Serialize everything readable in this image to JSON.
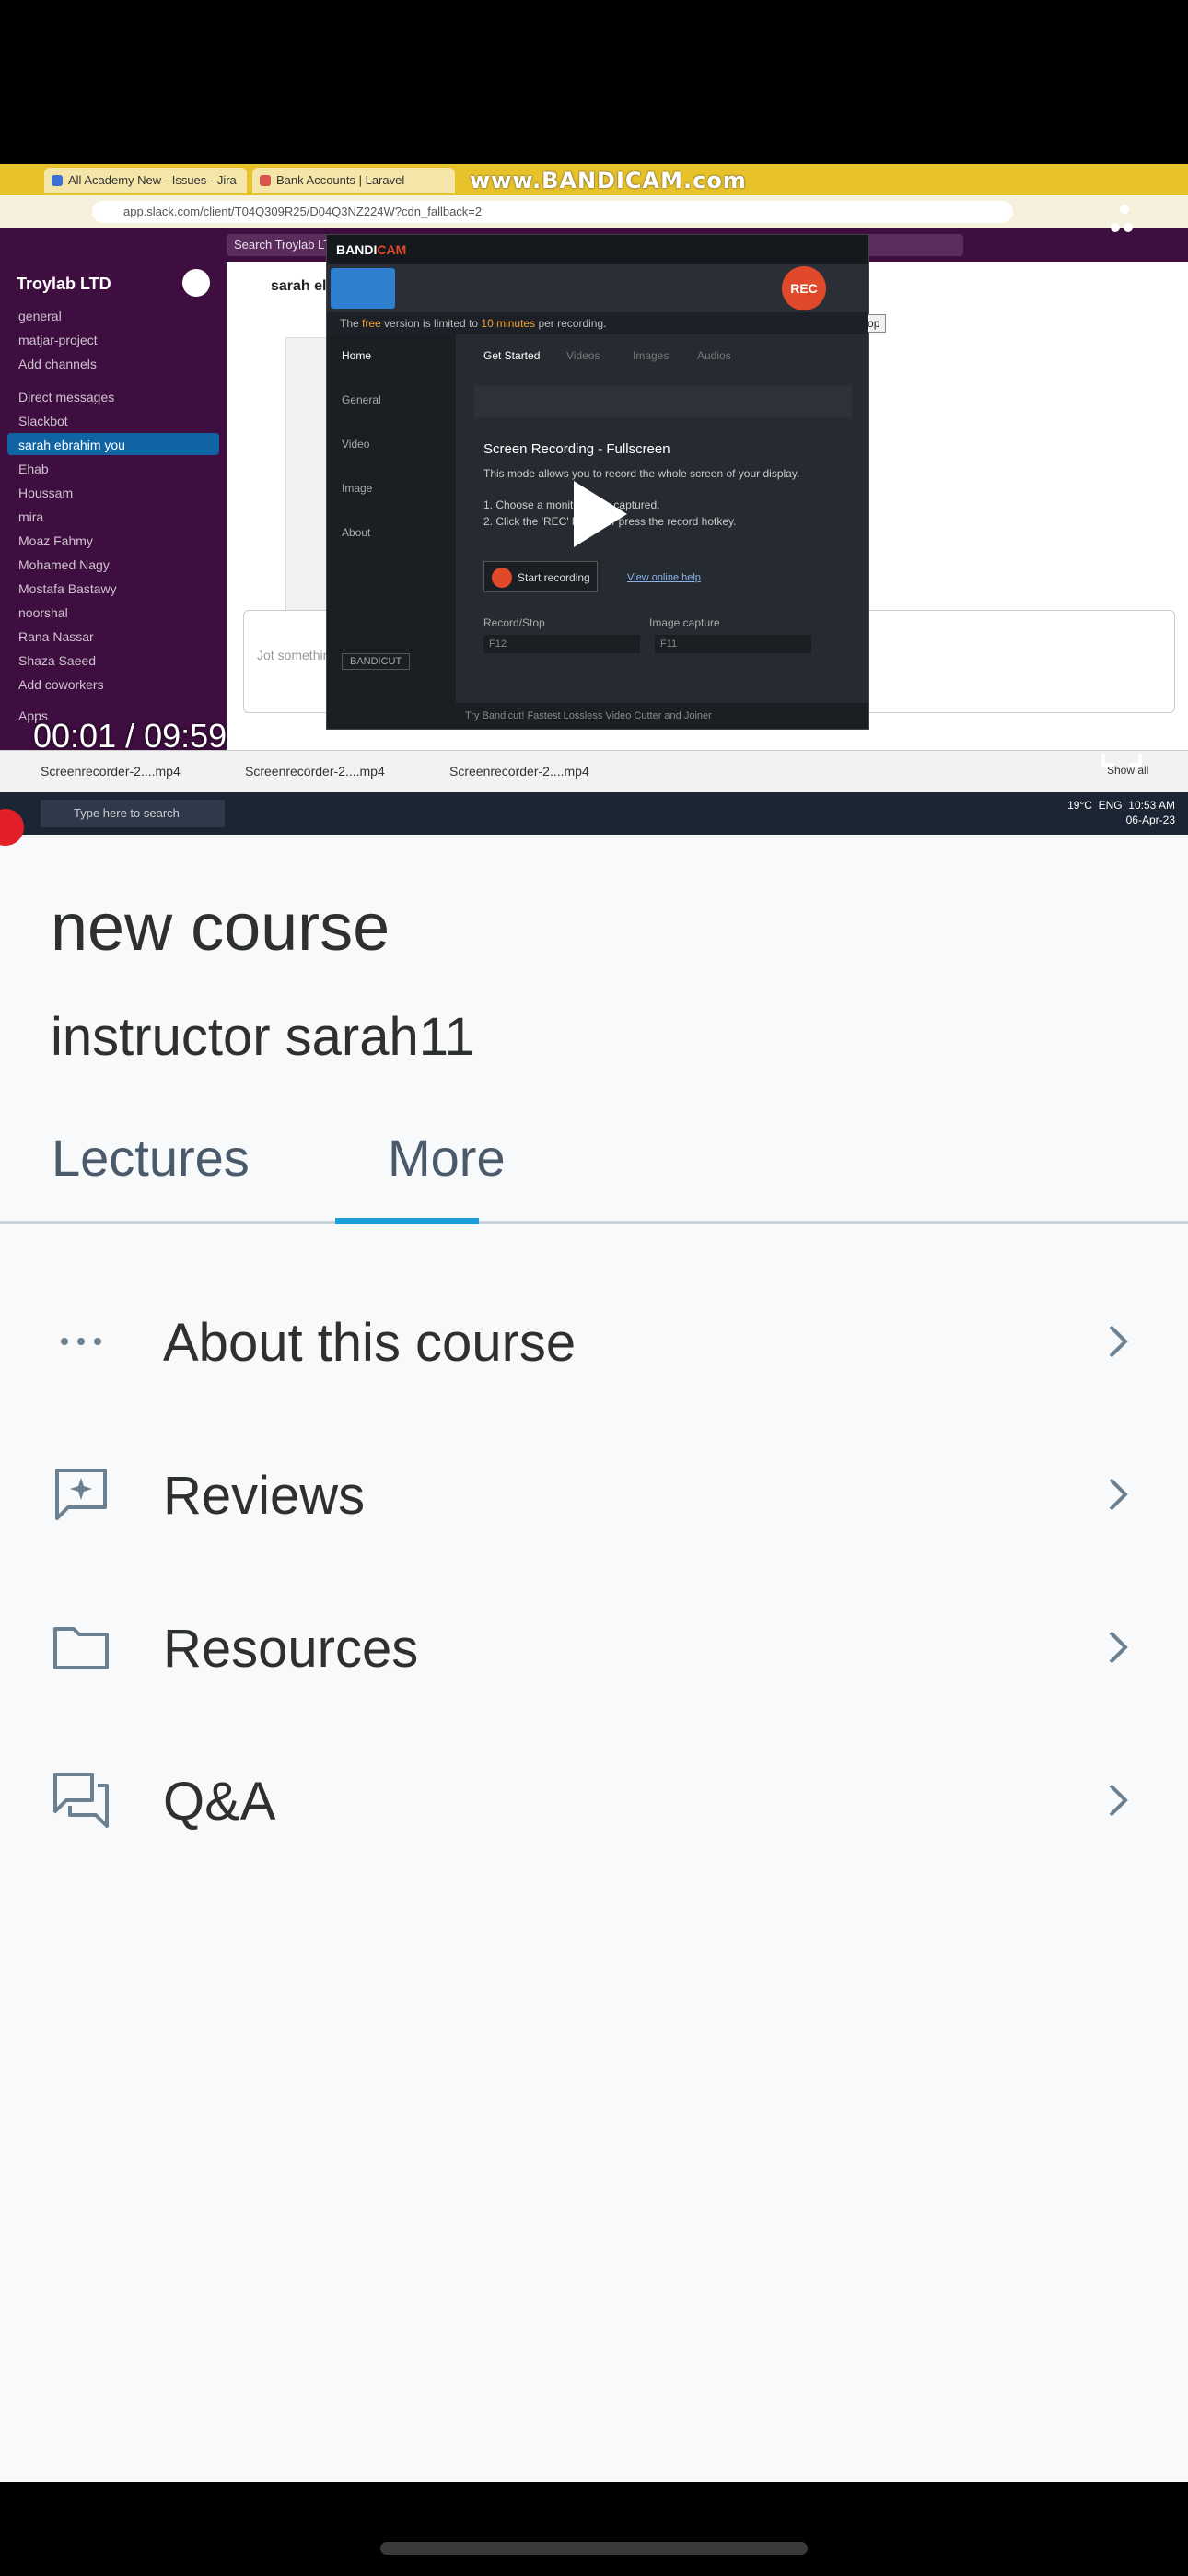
{
  "video": {
    "time_readout": "00:01 / 09:59",
    "recording": {
      "browser_tabs": [
        "All Academy New - Issues - Jira",
        "Bank Accounts | Laravel"
      ],
      "watermark": "www.BANDICAM.com",
      "address": "app.slack.com/client/T04Q309R25/D04Q3NZ224W?cdn_fallback=2",
      "slack_search": "Search Troylab LTD",
      "workspace": "Troylab LTD",
      "sidebar": {
        "channels": [
          "general",
          "matjar-project",
          "Add channels"
        ],
        "dm_header": "Direct messages",
        "dms": [
          "Slackbot",
          "sarah ebrahim  you",
          "Ehab",
          "Houssam",
          "mira",
          "Moaz Fahmy",
          "Mohamed Nagy",
          "Mostafa Bastawy",
          "noorshal",
          "Rana Nassar",
          "Shaza Saeed",
          "Add coworkers"
        ],
        "apps_header": "Apps"
      },
      "chat_header": "sarah el",
      "message_placeholder": "Jot somethin",
      "downloads": [
        "Screenrecorder-2....mp4",
        "Screenrecorder-2....mp4",
        "Screenrecorder-2....mp4"
      ],
      "show_all": "Show all",
      "taskbar_search": "Type here to search",
      "tray": {
        "weather": "19°C",
        "lang": "ENG",
        "time": "10:53 AM",
        "date": "06-Apr-23"
      },
      "bandicam": {
        "logo_a": "BANDI",
        "logo_b": "CAM",
        "rec": "REC",
        "rec_tooltip": "Record / Stop",
        "notice_a": "The ",
        "notice_free": "free",
        "notice_b": " version is limited to ",
        "notice_limit": "10 minutes",
        "notice_c": " per recording.",
        "nav": [
          "Home",
          "General",
          "Video",
          "Image",
          "About"
        ],
        "tabs": [
          "Get Started",
          "Videos",
          "Images",
          "Audios"
        ],
        "heading": "Screen Recording - Fullscreen",
        "desc": "This mode allows you to record the whole screen of your display.",
        "step1": "1. Choose a monitor to be captured.",
        "step2": "2. Click the 'REC' button or press the record hotkey.",
        "start": "Start recording",
        "help": "View online help",
        "hotkey1_label": "Record/Stop",
        "hotkey1": "F12",
        "hotkey2_label": "Image capture",
        "hotkey2": "F11",
        "bandicut": "BANDICUT",
        "footer": "Try Bandicut! Fastest Lossless Video Cutter and Joiner"
      }
    }
  },
  "course": {
    "title": "new course",
    "instructor": "instructor sarah11"
  },
  "tabs": {
    "items": [
      {
        "label": "Lectures"
      },
      {
        "label": "More"
      }
    ],
    "active": "More"
  },
  "menu": {
    "items": [
      {
        "label": "About this course",
        "icon": "more-dots-icon"
      },
      {
        "label": "Reviews",
        "icon": "review-sparkle-icon"
      },
      {
        "label": "Resources",
        "icon": "folder-icon"
      },
      {
        "label": "Q&A",
        "icon": "chat-bubbles-icon"
      }
    ]
  },
  "colors": {
    "accent": "#1c9fd6",
    "progress": "#e3202a",
    "background": "#f7f9fa",
    "text": "#2d2f31"
  }
}
